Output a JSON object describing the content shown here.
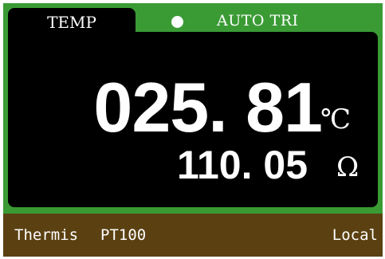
{
  "header": {
    "tab_label": "TEMP",
    "status_icon": "filled-circle",
    "mode_label": "AUTO TRI"
  },
  "reading": {
    "primary_value": "025. 81",
    "primary_unit": "℃",
    "secondary_value": "110. 05",
    "secondary_unit": "Ω"
  },
  "footer": {
    "sensor_type": "Thermis",
    "sensor_model": "PT100",
    "control_mode": "Local"
  },
  "colors": {
    "frame": "#3a9b35",
    "display_background": "#000000",
    "footer_background": "#5b4112",
    "text": "#ffffff"
  }
}
